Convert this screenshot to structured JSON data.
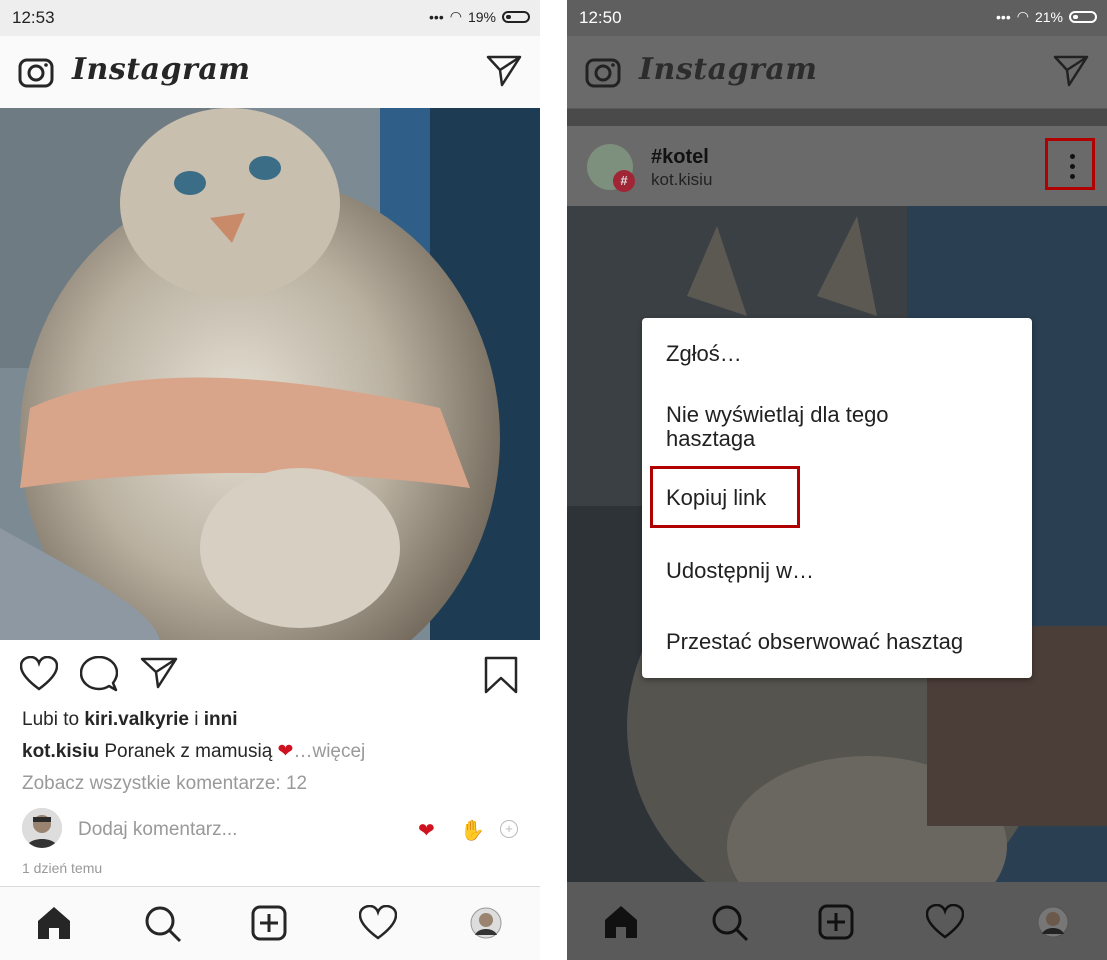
{
  "left": {
    "status": {
      "time": "12:53",
      "battery": "19%"
    },
    "header": {
      "logo": "Instagram"
    },
    "post": {
      "likes_prefix": "Lubi to",
      "likes_user": "kiri.valkyrie",
      "likes_join": "i",
      "likes_others": "inni",
      "caption_user": "kot.kisiu",
      "caption_text": "Poranek z mamusią",
      "caption_more": "…więcej",
      "view_comments": "Zobacz wszystkie komentarze: 12",
      "comment_placeholder": "Dodaj komentarz...",
      "timestamp": "1 dzień temu"
    },
    "icons": [
      "camera-icon",
      "send-icon",
      "heart-icon",
      "comment-icon",
      "share-icon",
      "bookmark-icon",
      "home-icon",
      "search-icon",
      "add-icon",
      "activity-icon",
      "profile-icon"
    ]
  },
  "right": {
    "status": {
      "time": "12:50",
      "battery": "21%"
    },
    "header": {
      "logo": "Instagram"
    },
    "hashtag": {
      "title": "#kotel",
      "user": "kot.kisiu"
    },
    "menu": {
      "items": [
        "Zgłoś…",
        "Nie wyświetlaj dla tego hasztaga",
        "Kopiuj link",
        "Udostępnij w…",
        "Przestać obserwować hasztag"
      ],
      "highlighted": "Kopiuj link"
    },
    "highlight_color": "#b00000"
  }
}
